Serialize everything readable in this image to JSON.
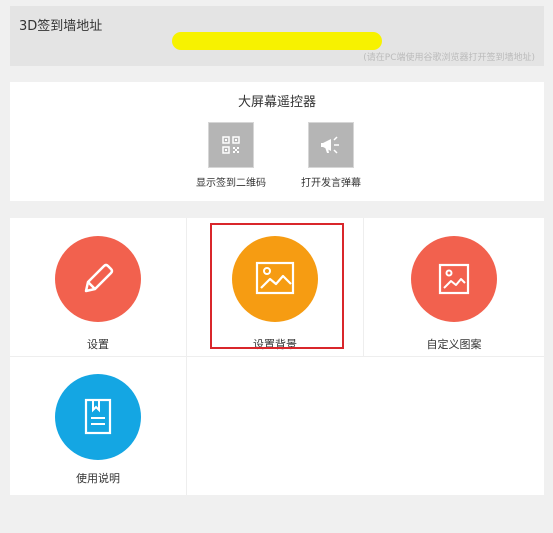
{
  "top": {
    "title": "3D签到墙地址",
    "hint": "(请在PC端使用谷歌浏览器打开签到墙地址)"
  },
  "remote": {
    "title": "大屏幕遥控器",
    "buttons": [
      {
        "label": "显示签到二维码",
        "icon": "qr-code-icon"
      },
      {
        "label": "打开发言弹幕",
        "icon": "megaphone-icon"
      }
    ]
  },
  "tiles": [
    {
      "label": "设置",
      "icon": "pencil-icon",
      "color": "#f2614e"
    },
    {
      "label": "设置背景",
      "icon": "image-icon",
      "color": "#f69c12"
    },
    {
      "label": "自定义图案",
      "icon": "picture-frame-icon",
      "color": "#f2614e"
    },
    {
      "label": "使用说明",
      "icon": "manual-book-icon",
      "color": "#14a6e3"
    }
  ],
  "colors": {
    "accent_red": "#f2614e",
    "accent_orange": "#f69c12",
    "accent_blue": "#14a6e3",
    "highlight": "#d9262b",
    "url_highlight": "#f7f200"
  }
}
